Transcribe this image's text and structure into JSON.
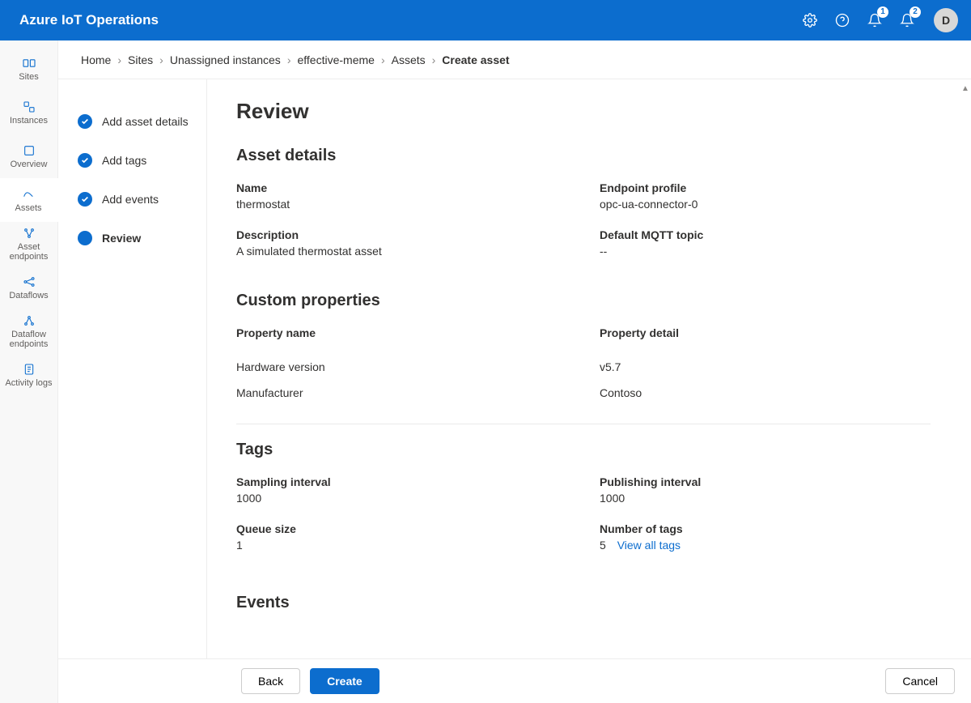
{
  "header": {
    "title": "Azure IoT Operations",
    "badge1": "1",
    "badge2": "2",
    "avatar_initial": "D"
  },
  "sidebar": {
    "items": [
      {
        "id": "sites",
        "label": "Sites"
      },
      {
        "id": "instances",
        "label": "Instances"
      },
      {
        "id": "overview",
        "label": "Overview"
      },
      {
        "id": "assets",
        "label": "Assets",
        "active": true
      },
      {
        "id": "asset-endpoints",
        "label": "Asset endpoints"
      },
      {
        "id": "dataflows",
        "label": "Dataflows"
      },
      {
        "id": "dataflow-endpoints",
        "label": "Dataflow endpoints"
      },
      {
        "id": "activity-logs",
        "label": "Activity logs"
      }
    ]
  },
  "breadcrumb": {
    "items": [
      "Home",
      "Sites",
      "Unassigned instances",
      "effective-meme",
      "Assets"
    ],
    "current": "Create asset"
  },
  "steps": {
    "items": [
      {
        "label": "Add asset details",
        "done": true
      },
      {
        "label": "Add tags",
        "done": true
      },
      {
        "label": "Add events",
        "done": true
      },
      {
        "label": "Review",
        "current": true
      }
    ]
  },
  "review": {
    "heading": "Review",
    "sections": {
      "asset_details": {
        "title": "Asset details",
        "name_label": "Name",
        "name_value": "thermostat",
        "endpoint_label": "Endpoint profile",
        "endpoint_value": "opc-ua-connector-0",
        "description_label": "Description",
        "description_value": "A simulated thermostat asset",
        "mqtt_label": "Default MQTT topic",
        "mqtt_value": "--"
      },
      "custom_properties": {
        "title": "Custom properties",
        "propname_label": "Property name",
        "propdetail_label": "Property detail",
        "rows": [
          {
            "name": "Hardware version",
            "detail": "v5.7"
          },
          {
            "name": "Manufacturer",
            "detail": "Contoso"
          }
        ]
      },
      "tags": {
        "title": "Tags",
        "sampling_label": "Sampling interval",
        "sampling_value": "1000",
        "publishing_label": "Publishing interval",
        "publishing_value": "1000",
        "queue_label": "Queue size",
        "queue_value": "1",
        "numtags_label": "Number of tags",
        "numtags_value": "5",
        "view_all_link": "View all tags"
      },
      "events": {
        "title": "Events"
      }
    }
  },
  "footer": {
    "back": "Back",
    "create": "Create",
    "cancel": "Cancel"
  }
}
